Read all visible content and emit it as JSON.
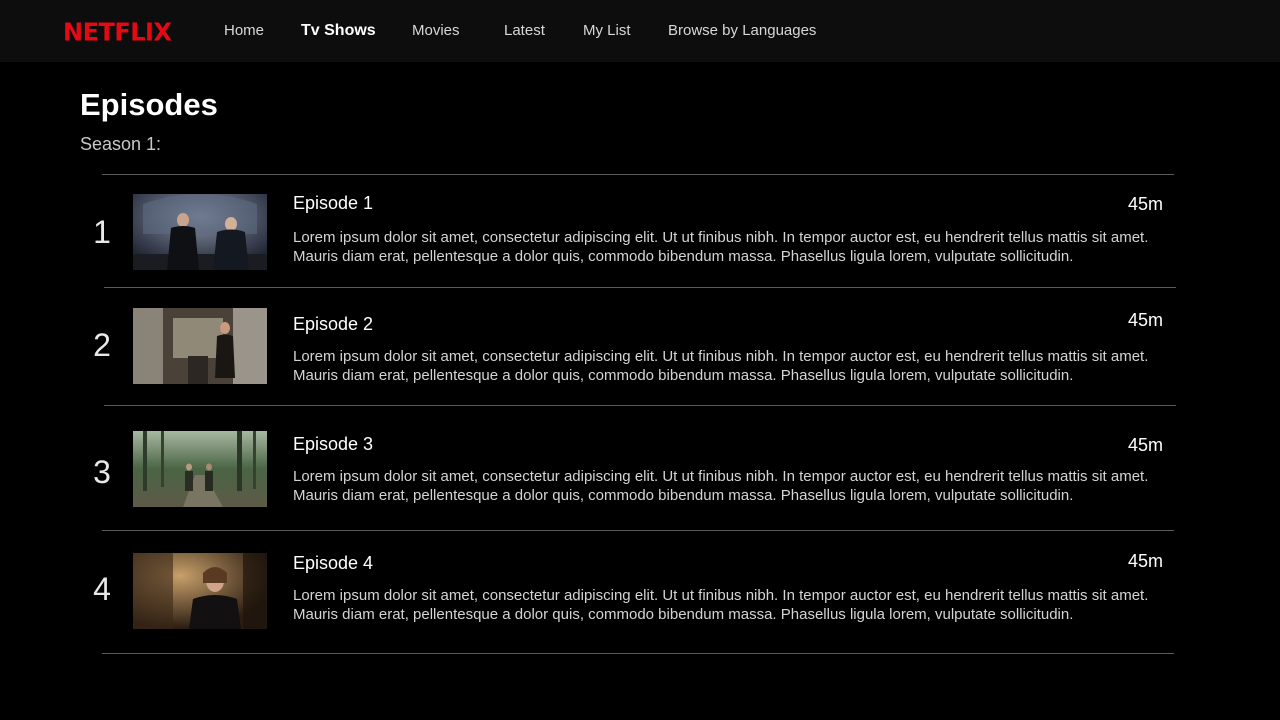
{
  "brand": {
    "logo_text": "NETFLIX",
    "color": "#e50914"
  },
  "nav": {
    "items": [
      {
        "label": "Home",
        "active": false
      },
      {
        "label": "Tv Shows",
        "active": true
      },
      {
        "label": "Movies",
        "active": false
      },
      {
        "label": "Latest",
        "active": false
      },
      {
        "label": "My List",
        "active": false
      },
      {
        "label": "Browse by Languages",
        "active": false
      }
    ]
  },
  "page": {
    "title": "Episodes",
    "season_label": "Season 1:"
  },
  "episodes": [
    {
      "number": "1",
      "title": "Episode 1",
      "duration": "45m",
      "description": "Lorem ipsum dolor sit amet, consectetur adipiscing elit. Ut ut finibus nibh. In tempor auctor est, eu hendrerit tellus mattis sit amet. Mauris diam erat, pellentesque a dolor quis, commodo bibendum massa. Phasellus ligula lorem, vulputate sollicitudin."
    },
    {
      "number": "2",
      "title": "Episode 2",
      "duration": "45m",
      "description": "Lorem ipsum dolor sit amet, consectetur adipiscing elit. Ut ut finibus nibh. In tempor auctor est, eu hendrerit tellus mattis sit amet. Mauris diam erat, pellentesque a dolor quis, commodo bibendum massa. Phasellus ligula lorem, vulputate sollicitudin."
    },
    {
      "number": "3",
      "title": "Episode 3",
      "duration": "45m",
      "description": "Lorem ipsum dolor sit amet, consectetur adipiscing elit. Ut ut finibus nibh. In tempor auctor est, eu hendrerit tellus mattis sit amet. Mauris diam erat, pellentesque a dolor quis, commodo bibendum massa. Phasellus ligula lorem, vulputate sollicitudin."
    },
    {
      "number": "4",
      "title": "Episode 4",
      "duration": "45m",
      "description": "Lorem ipsum dolor sit amet, consectetur adipiscing elit. Ut ut finibus nibh. In tempor auctor est, eu hendrerit tellus mattis sit amet. Mauris diam erat, pellentesque a dolor quis, commodo bibendum massa. Phasellus ligula lorem, vulputate sollicitudin."
    }
  ]
}
